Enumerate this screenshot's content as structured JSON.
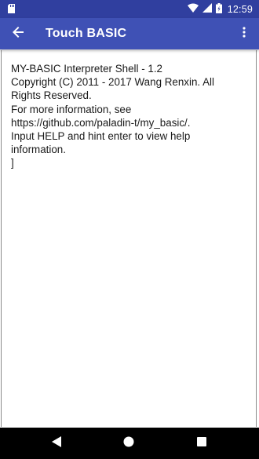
{
  "status_bar": {
    "time": "12:59",
    "icons": [
      "sd-card-icon",
      "wifi-icon",
      "cellular-signal-icon",
      "battery-icon"
    ],
    "color": "#303f9f"
  },
  "app_bar": {
    "title": "Touch BASIC",
    "back_icon": "arrow-back-icon",
    "menu_icon": "more-vert-icon",
    "color": "#3f51b5"
  },
  "console": {
    "lines": [
      "MY-BASIC Interpreter Shell - 1.2",
      "Copyright (C) 2011 - 2017 Wang Renxin. All Rights Reserved.",
      "For more information, see https://github.com/paladin-t/my_basic/.",
      "Input HELP and hint enter to view help information.",
      "]"
    ]
  },
  "nav_bar": {
    "icons": [
      "back-triangle-icon",
      "home-circle-icon",
      "recents-square-icon"
    ],
    "color": "#000000"
  }
}
